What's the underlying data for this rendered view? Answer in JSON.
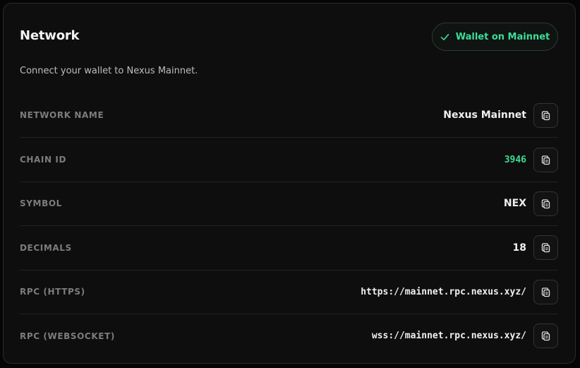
{
  "header": {
    "title": "Network",
    "status_label": "Wallet on Mainnet",
    "status_icon": "check-icon",
    "subtitle": "Connect your wallet to Nexus Mainnet."
  },
  "colors": {
    "accent": "#3ddc97",
    "background": "#0e0e0e",
    "label": "#7c7c7c"
  },
  "rows": [
    {
      "key": "network-name",
      "label": "NETWORK NAME",
      "value": "Nexus Mainnet",
      "copy_icon": "copy-icon"
    },
    {
      "key": "chain-id",
      "label": "CHAIN ID",
      "value": "3946",
      "copy_icon": "copy-icon"
    },
    {
      "key": "symbol",
      "label": "SYMBOL",
      "value": "NEX",
      "copy_icon": "copy-icon"
    },
    {
      "key": "decimals",
      "label": "DECIMALS",
      "value": "18",
      "copy_icon": "copy-icon"
    },
    {
      "key": "rpc-https",
      "label": "RPC (HTTPS)",
      "value": "https://mainnet.rpc.nexus.xyz/",
      "copy_icon": "copy-icon"
    },
    {
      "key": "rpc-websocket",
      "label": "RPC (WEBSOCKET)",
      "value": "wss://mainnet.rpc.nexus.xyz/",
      "copy_icon": "copy-icon"
    }
  ]
}
